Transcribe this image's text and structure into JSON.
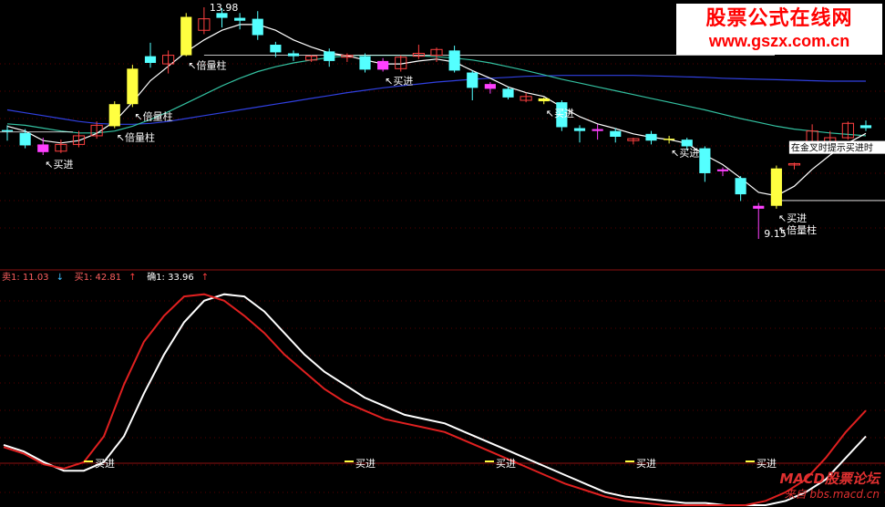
{
  "watermark": {
    "title": "股票公式在线网",
    "url": "www.gszx.com.cn"
  },
  "watermark2": {
    "title": "MACD股票论坛",
    "url": "bbs.macd.cn",
    "prefix": "来自"
  },
  "colors": {
    "up": "#ff4040",
    "down": "#54ffff",
    "vol_bar": "#ffff40",
    "pink_bar": "#ff40ff",
    "ma_short": "#ffffff",
    "ma_mid": "#33c0a0",
    "ma_long": "#3040e0",
    "line_white": "#ffffff",
    "line_red": "#e02020",
    "divider": "#8b1010",
    "grid": "#5a0000"
  },
  "chart_data": [
    {
      "type": "candlestick",
      "price_labels": {
        "high": "13.98",
        "low": "9.15"
      },
      "candles": [
        {
          "o": 11.4,
          "c": 11.42,
          "h": 11.52,
          "l": 11.2,
          "k": "down"
        },
        {
          "o": 11.36,
          "c": 11.1,
          "h": 11.44,
          "l": 11.04,
          "k": "down"
        },
        {
          "o": 11.12,
          "c": 10.96,
          "h": 11.26,
          "l": 10.9,
          "k": "pink"
        },
        {
          "o": 10.98,
          "c": 11.12,
          "h": 11.22,
          "l": 10.94,
          "k": "up"
        },
        {
          "o": 11.12,
          "c": 11.3,
          "h": 11.4,
          "l": 11.06,
          "k": "up"
        },
        {
          "o": 11.3,
          "c": 11.52,
          "h": 11.6,
          "l": 11.24,
          "k": "up"
        },
        {
          "o": 11.5,
          "c": 11.96,
          "h": 12.02,
          "l": 11.46,
          "k": "gold"
        },
        {
          "o": 11.96,
          "c": 12.7,
          "h": 12.78,
          "l": 11.9,
          "k": "gold"
        },
        {
          "o": 12.82,
          "c": 12.96,
          "h": 13.24,
          "l": 12.72,
          "k": "down"
        },
        {
          "o": 12.8,
          "c": 12.98,
          "h": 13.08,
          "l": 12.6,
          "k": "up"
        },
        {
          "o": 12.98,
          "c": 13.78,
          "h": 13.86,
          "l": 12.96,
          "k": "gold"
        },
        {
          "o": 13.74,
          "c": 13.5,
          "h": 13.98,
          "l": 13.42,
          "k": "up"
        },
        {
          "o": 13.86,
          "c": 13.76,
          "h": 13.96,
          "l": 13.56,
          "k": "down"
        },
        {
          "o": 13.76,
          "c": 13.7,
          "h": 13.86,
          "l": 13.52,
          "k": "down"
        },
        {
          "o": 13.74,
          "c": 13.4,
          "h": 13.9,
          "l": 13.3,
          "k": "down"
        },
        {
          "o": 13.2,
          "c": 13.04,
          "h": 13.26,
          "l": 12.94,
          "k": "down"
        },
        {
          "o": 13.02,
          "c": 12.96,
          "h": 13.08,
          "l": 12.86,
          "k": "down"
        },
        {
          "o": 12.96,
          "c": 12.88,
          "h": 12.98,
          "l": 12.84,
          "k": "up"
        },
        {
          "o": 13.06,
          "c": 12.86,
          "h": 13.12,
          "l": 12.74,
          "k": "down"
        },
        {
          "o": 12.98,
          "c": 12.94,
          "h": 13.02,
          "l": 12.84,
          "k": "up"
        },
        {
          "o": 12.96,
          "c": 12.68,
          "h": 13.02,
          "l": 12.62,
          "k": "down"
        },
        {
          "o": 12.86,
          "c": 12.68,
          "h": 12.92,
          "l": 12.64,
          "k": "pink"
        },
        {
          "o": 12.7,
          "c": 12.94,
          "h": 12.98,
          "l": 12.64,
          "k": "up"
        },
        {
          "o": 12.96,
          "c": 13.02,
          "h": 13.2,
          "l": 12.9,
          "k": "up"
        },
        {
          "o": 13.1,
          "c": 12.98,
          "h": 13.14,
          "l": 12.84,
          "k": "up"
        },
        {
          "o": 13.08,
          "c": 12.66,
          "h": 13.18,
          "l": 12.62,
          "k": "down"
        },
        {
          "o": 12.62,
          "c": 12.3,
          "h": 12.66,
          "l": 12.04,
          "k": "down"
        },
        {
          "o": 12.38,
          "c": 12.28,
          "h": 12.42,
          "l": 12.18,
          "k": "pink"
        },
        {
          "o": 12.28,
          "c": 12.1,
          "h": 12.32,
          "l": 12.06,
          "k": "down"
        },
        {
          "o": 12.12,
          "c": 12.04,
          "h": 12.2,
          "l": 12.0,
          "k": "up"
        },
        {
          "o": 12.08,
          "c": 12.02,
          "h": 12.1,
          "l": 11.96,
          "k": "gold"
        },
        {
          "o": 12.0,
          "c": 11.48,
          "h": 12.04,
          "l": 11.4,
          "k": "down"
        },
        {
          "o": 11.46,
          "c": 11.4,
          "h": 11.52,
          "l": 11.16,
          "k": "down"
        },
        {
          "o": 11.44,
          "c": 11.4,
          "h": 11.54,
          "l": 11.22,
          "k": "pink"
        },
        {
          "o": 11.4,
          "c": 11.28,
          "h": 11.46,
          "l": 11.16,
          "k": "down"
        },
        {
          "o": 11.2,
          "c": 11.24,
          "h": 11.26,
          "l": 11.12,
          "k": "up"
        },
        {
          "o": 11.34,
          "c": 11.2,
          "h": 11.4,
          "l": 11.12,
          "k": "down"
        },
        {
          "o": 11.24,
          "c": 11.22,
          "h": 11.3,
          "l": 11.14,
          "k": "gold"
        },
        {
          "o": 11.22,
          "c": 11.08,
          "h": 11.26,
          "l": 11.0,
          "k": "down"
        },
        {
          "o": 11.04,
          "c": 10.52,
          "h": 11.08,
          "l": 10.34,
          "k": "down"
        },
        {
          "o": 10.6,
          "c": 10.56,
          "h": 10.64,
          "l": 10.46,
          "k": "pink"
        },
        {
          "o": 10.42,
          "c": 10.08,
          "h": 10.46,
          "l": 9.94,
          "k": "down"
        },
        {
          "o": 9.84,
          "c": 9.78,
          "h": 9.9,
          "l": 9.15,
          "k": "pink"
        },
        {
          "o": 9.84,
          "c": 10.62,
          "h": 10.68,
          "l": 9.78,
          "k": "gold"
        },
        {
          "o": 10.7,
          "c": 10.72,
          "h": 10.74,
          "l": 10.6,
          "k": "up"
        },
        {
          "o": 11.1,
          "c": 11.4,
          "h": 11.54,
          "l": 11.04,
          "k": "up"
        },
        {
          "o": 11.08,
          "c": 11.26,
          "h": 11.4,
          "l": 11.02,
          "k": "up"
        },
        {
          "o": 11.26,
          "c": 11.56,
          "h": 11.6,
          "l": 11.22,
          "k": "up"
        },
        {
          "o": 11.52,
          "c": 11.46,
          "h": 11.62,
          "l": 11.4,
          "k": "down"
        }
      ],
      "ma_short": [
        11.5,
        11.4,
        11.2,
        11.15,
        11.2,
        11.35,
        11.6,
        12.0,
        12.45,
        12.75,
        13.05,
        13.3,
        13.5,
        13.62,
        13.62,
        13.5,
        13.3,
        13.15,
        13.03,
        12.97,
        12.88,
        12.8,
        12.8,
        12.86,
        12.9,
        12.84,
        12.66,
        12.5,
        12.32,
        12.2,
        12.12,
        11.9,
        11.7,
        11.55,
        11.45,
        11.34,
        11.27,
        11.22,
        11.14,
        10.9,
        10.7,
        10.42,
        10.12,
        10.05,
        10.25,
        10.6,
        10.9,
        11.15,
        11.35
      ],
      "ma_mid": [
        11.55,
        11.52,
        11.46,
        11.4,
        11.36,
        11.36,
        11.4,
        11.5,
        11.64,
        11.8,
        11.98,
        12.16,
        12.34,
        12.5,
        12.64,
        12.74,
        12.82,
        12.88,
        12.93,
        12.97,
        12.98,
        12.98,
        12.98,
        12.97,
        12.95,
        12.92,
        12.88,
        12.82,
        12.74,
        12.66,
        12.57,
        12.48,
        12.4,
        12.32,
        12.24,
        12.16,
        12.08,
        12.0,
        11.92,
        11.84,
        11.75,
        11.66,
        11.58,
        11.5,
        11.44,
        11.4,
        11.36,
        11.33,
        11.3
      ],
      "ma_long": [
        11.84,
        11.78,
        11.72,
        11.66,
        11.6,
        11.56,
        11.54,
        11.54,
        11.56,
        11.6,
        11.66,
        11.72,
        11.78,
        11.84,
        11.9,
        11.96,
        12.02,
        12.08,
        12.14,
        12.2,
        12.25,
        12.3,
        12.34,
        12.38,
        12.42,
        12.45,
        12.48,
        12.5,
        12.52,
        12.54,
        12.55,
        12.56,
        12.56,
        12.56,
        12.56,
        12.56,
        12.55,
        12.54,
        12.53,
        12.52,
        12.5,
        12.49,
        12.48,
        12.47,
        12.46,
        12.45,
        12.44,
        12.44,
        12.44
      ],
      "annotations": [
        {
          "label": "买进",
          "i": 2
        },
        {
          "label": "倍量柱",
          "i": 6
        },
        {
          "label": "倍量柱",
          "i": 7
        },
        {
          "label": "倍量柱",
          "i": 10
        },
        {
          "label": "买进",
          "i": 21
        },
        {
          "label": "买进",
          "i": 30
        },
        {
          "label": "买进",
          "i": 37
        },
        {
          "label": "买进",
          "i": 43
        },
        {
          "label": "倍量柱",
          "i": 43
        }
      ],
      "callout": "在金叉时提示买进时"
    },
    {
      "type": "line",
      "legend": [
        {
          "label": "卖1: 11.03",
          "arrow": "↓"
        },
        {
          "label": "买1: 42.81",
          "arrow": "↑"
        },
        {
          "label": "确1: 33.96",
          "arrow": "↑"
        }
      ],
      "ylim": [
        0,
        100
      ],
      "series": [
        {
          "color": "#ffffff",
          "values": [
            28,
            25,
            20,
            16,
            16,
            20,
            32,
            52,
            70,
            85,
            95,
            98,
            97,
            90,
            80,
            70,
            62,
            56,
            50,
            46,
            42,
            40,
            38,
            34,
            30,
            26,
            22,
            18,
            14,
            10,
            6,
            4,
            3,
            2,
            1,
            1,
            0,
            0,
            0,
            2,
            6,
            12,
            22,
            32
          ]
        },
        {
          "color": "#e02020",
          "values": [
            27,
            24,
            19,
            17,
            20,
            32,
            56,
            76,
            88,
            97,
            98,
            95,
            88,
            80,
            70,
            62,
            54,
            48,
            44,
            40,
            38,
            36,
            34,
            30,
            26,
            22,
            18,
            14,
            10,
            7,
            4,
            2,
            1,
            0,
            0,
            0,
            0,
            0,
            2,
            6,
            12,
            22,
            34,
            44
          ]
        }
      ],
      "signals": [
        {
          "label": "买进",
          "i": 4
        },
        {
          "label": "买进",
          "i": 17
        },
        {
          "label": "买进",
          "i": 24
        },
        {
          "label": "买进",
          "i": 31
        },
        {
          "label": "买进",
          "i": 37
        }
      ]
    }
  ]
}
